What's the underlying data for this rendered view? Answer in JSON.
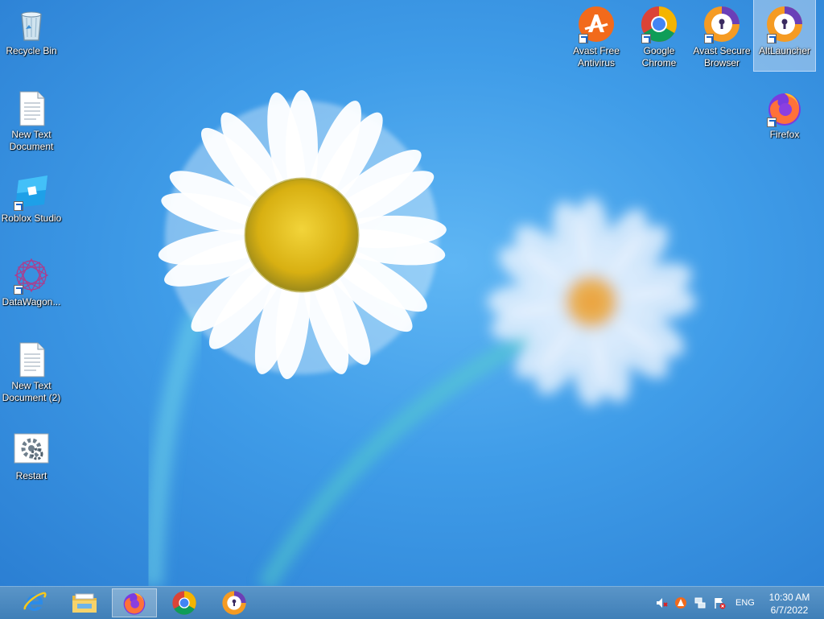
{
  "desktop": {
    "icons_left": [
      {
        "label": "Recycle Bin",
        "icon": "recycle-bin-icon"
      },
      {
        "label": "New Text Document",
        "icon": "text-document-icon"
      },
      {
        "label": "Roblox Studio",
        "icon": "roblox-studio-icon"
      },
      {
        "label": "DataWagon...",
        "icon": "datawagon-icon"
      },
      {
        "label": "New Text Document (2)",
        "icon": "text-document-icon"
      },
      {
        "label": "Restart",
        "icon": "restart-icon"
      }
    ],
    "icons_right": [
      {
        "label": "Avast Free Antivirus",
        "icon": "avast-antivirus-icon"
      },
      {
        "label": "Google Chrome",
        "icon": "chrome-icon"
      },
      {
        "label": "Avast Secure Browser",
        "icon": "avast-browser-icon"
      },
      {
        "label": "AltLauncher",
        "icon": "altlauncher-icon",
        "selected": true
      },
      {
        "label": "Firefox",
        "icon": "firefox-icon"
      }
    ]
  },
  "taskbar": {
    "pinned": [
      {
        "name": "Internet Explorer",
        "icon": "ie-icon"
      },
      {
        "name": "File Explorer",
        "icon": "file-explorer-icon"
      },
      {
        "name": "Firefox",
        "icon": "firefox-icon",
        "active": true
      },
      {
        "name": "Google Chrome",
        "icon": "chrome-icon"
      },
      {
        "name": "Avast Secure Browser",
        "icon": "avast-browser-icon"
      }
    ],
    "tray": {
      "icons": [
        "volume-muted-icon",
        "avast-tray-icon",
        "network-icon",
        "action-center-icon"
      ],
      "language": "ENG",
      "time": "10:30 AM",
      "date": "6/7/2022"
    }
  },
  "colors": {
    "sky": "#3f9ce8",
    "taskbar": "#4a88c0",
    "daisy_center": "#e8c21a"
  }
}
